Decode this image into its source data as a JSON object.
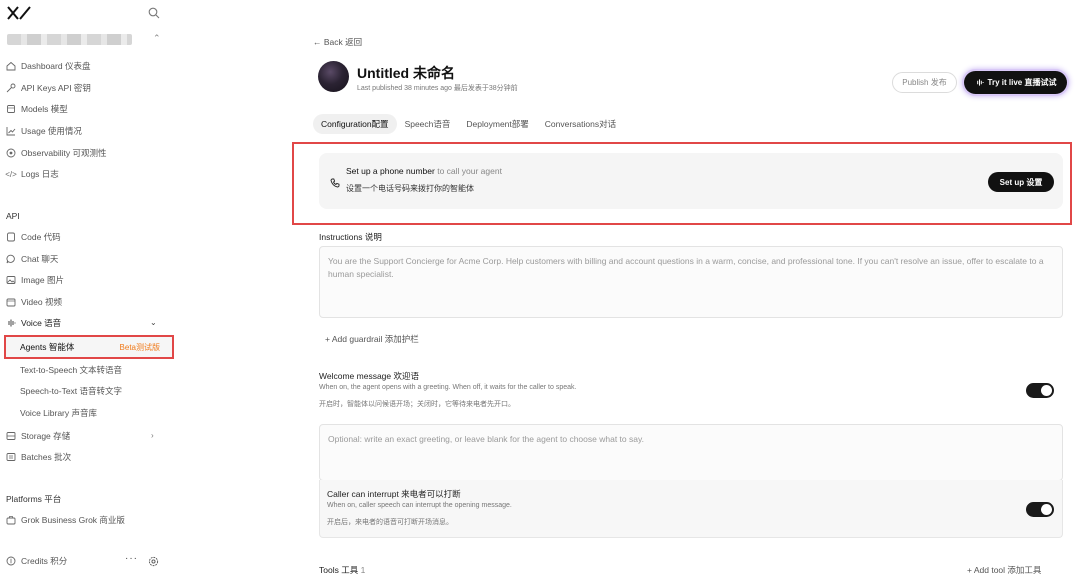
{
  "sidebar": {
    "nav": [
      {
        "label": "Dashboard 仪表盘",
        "icon": "home-icon"
      },
      {
        "label": "API Keys API 密钥",
        "icon": "key-icon"
      },
      {
        "label": "Models 模型",
        "icon": "cube-icon"
      },
      {
        "label": "Usage 使用情况",
        "icon": "chart-icon"
      },
      {
        "label": "Observability 可观测性",
        "icon": "eye-icon"
      },
      {
        "label": "Logs 日志",
        "icon": "code-icon"
      }
    ],
    "api_section": "API",
    "api_items": [
      {
        "label": "Code 代码",
        "icon": "code-file-icon"
      },
      {
        "label": "Chat 聊天",
        "icon": "chat-bubble-icon"
      },
      {
        "label": "Image 图片",
        "icon": "image-icon"
      },
      {
        "label": "Video 视频",
        "icon": "video-icon"
      },
      {
        "label": "Voice 语音",
        "icon": "waveform-icon"
      }
    ],
    "agents_label": "Agents 智能体",
    "agents_badge": "Beta测试版",
    "voice_sub": [
      "Text-to-Speech 文本转语音",
      "Speech-to-Text 语音转文字",
      "Voice Library 声音库"
    ],
    "storage_label": "Storage 存储",
    "batches_label": "Batches 批次",
    "platforms_section": "Platforms 平台",
    "grok_business": "Grok Business Grok 商业版",
    "credits": "Credits 积分",
    "more": "···"
  },
  "main": {
    "back": "← Back 返回",
    "title": "Untitled 未命名",
    "subtitle": "Last published 38 minutes ago 最后发表于38分钟前",
    "publish": "Publish 发布",
    "try_live": "Try it live 直播试试",
    "tabs": [
      "Configuration配置",
      "Speech语音",
      "Deployment部署",
      "Conversations对话"
    ],
    "phone": {
      "line1_main": "Set up a phone number",
      "line1_muted": " to call your agent",
      "line2": "设置一个电话号码来拨打你的智能体",
      "button": "Set up 设置"
    },
    "instructions": {
      "label": "Instructions 说明",
      "placeholder": "You are the Support Concierge for Acme Corp. Help customers with billing and account questions in a warm, concise, and professional tone. If you can't resolve an issue, offer to escalate to a human specialist."
    },
    "add_guardrail": "+ Add guardrail 添加护栏",
    "welcome": {
      "label": "Welcome message 欢迎语",
      "desc_en": "When on, the agent opens with a greeting. When off, it waits for the caller to speak.",
      "desc_zh": "开启时，智能体以问候语开场；关闭时，它等待来电者先开口。",
      "placeholder": "Optional: write an exact greeting, or leave blank for the agent to choose what to say."
    },
    "interrupt": {
      "label": "Caller can interrupt 来电者可以打断",
      "desc_en": "When on, caller speech can interrupt the opening message.",
      "desc_zh": "开启后，来电者的语音可打断开场消息。"
    },
    "tools_label": "Tools 工具",
    "tools_count": "1",
    "add_tool": "+ Add tool 添加工具"
  },
  "colors": {
    "highlight": "#e14747",
    "beta": "#f07a1a",
    "dark": "#111111"
  }
}
